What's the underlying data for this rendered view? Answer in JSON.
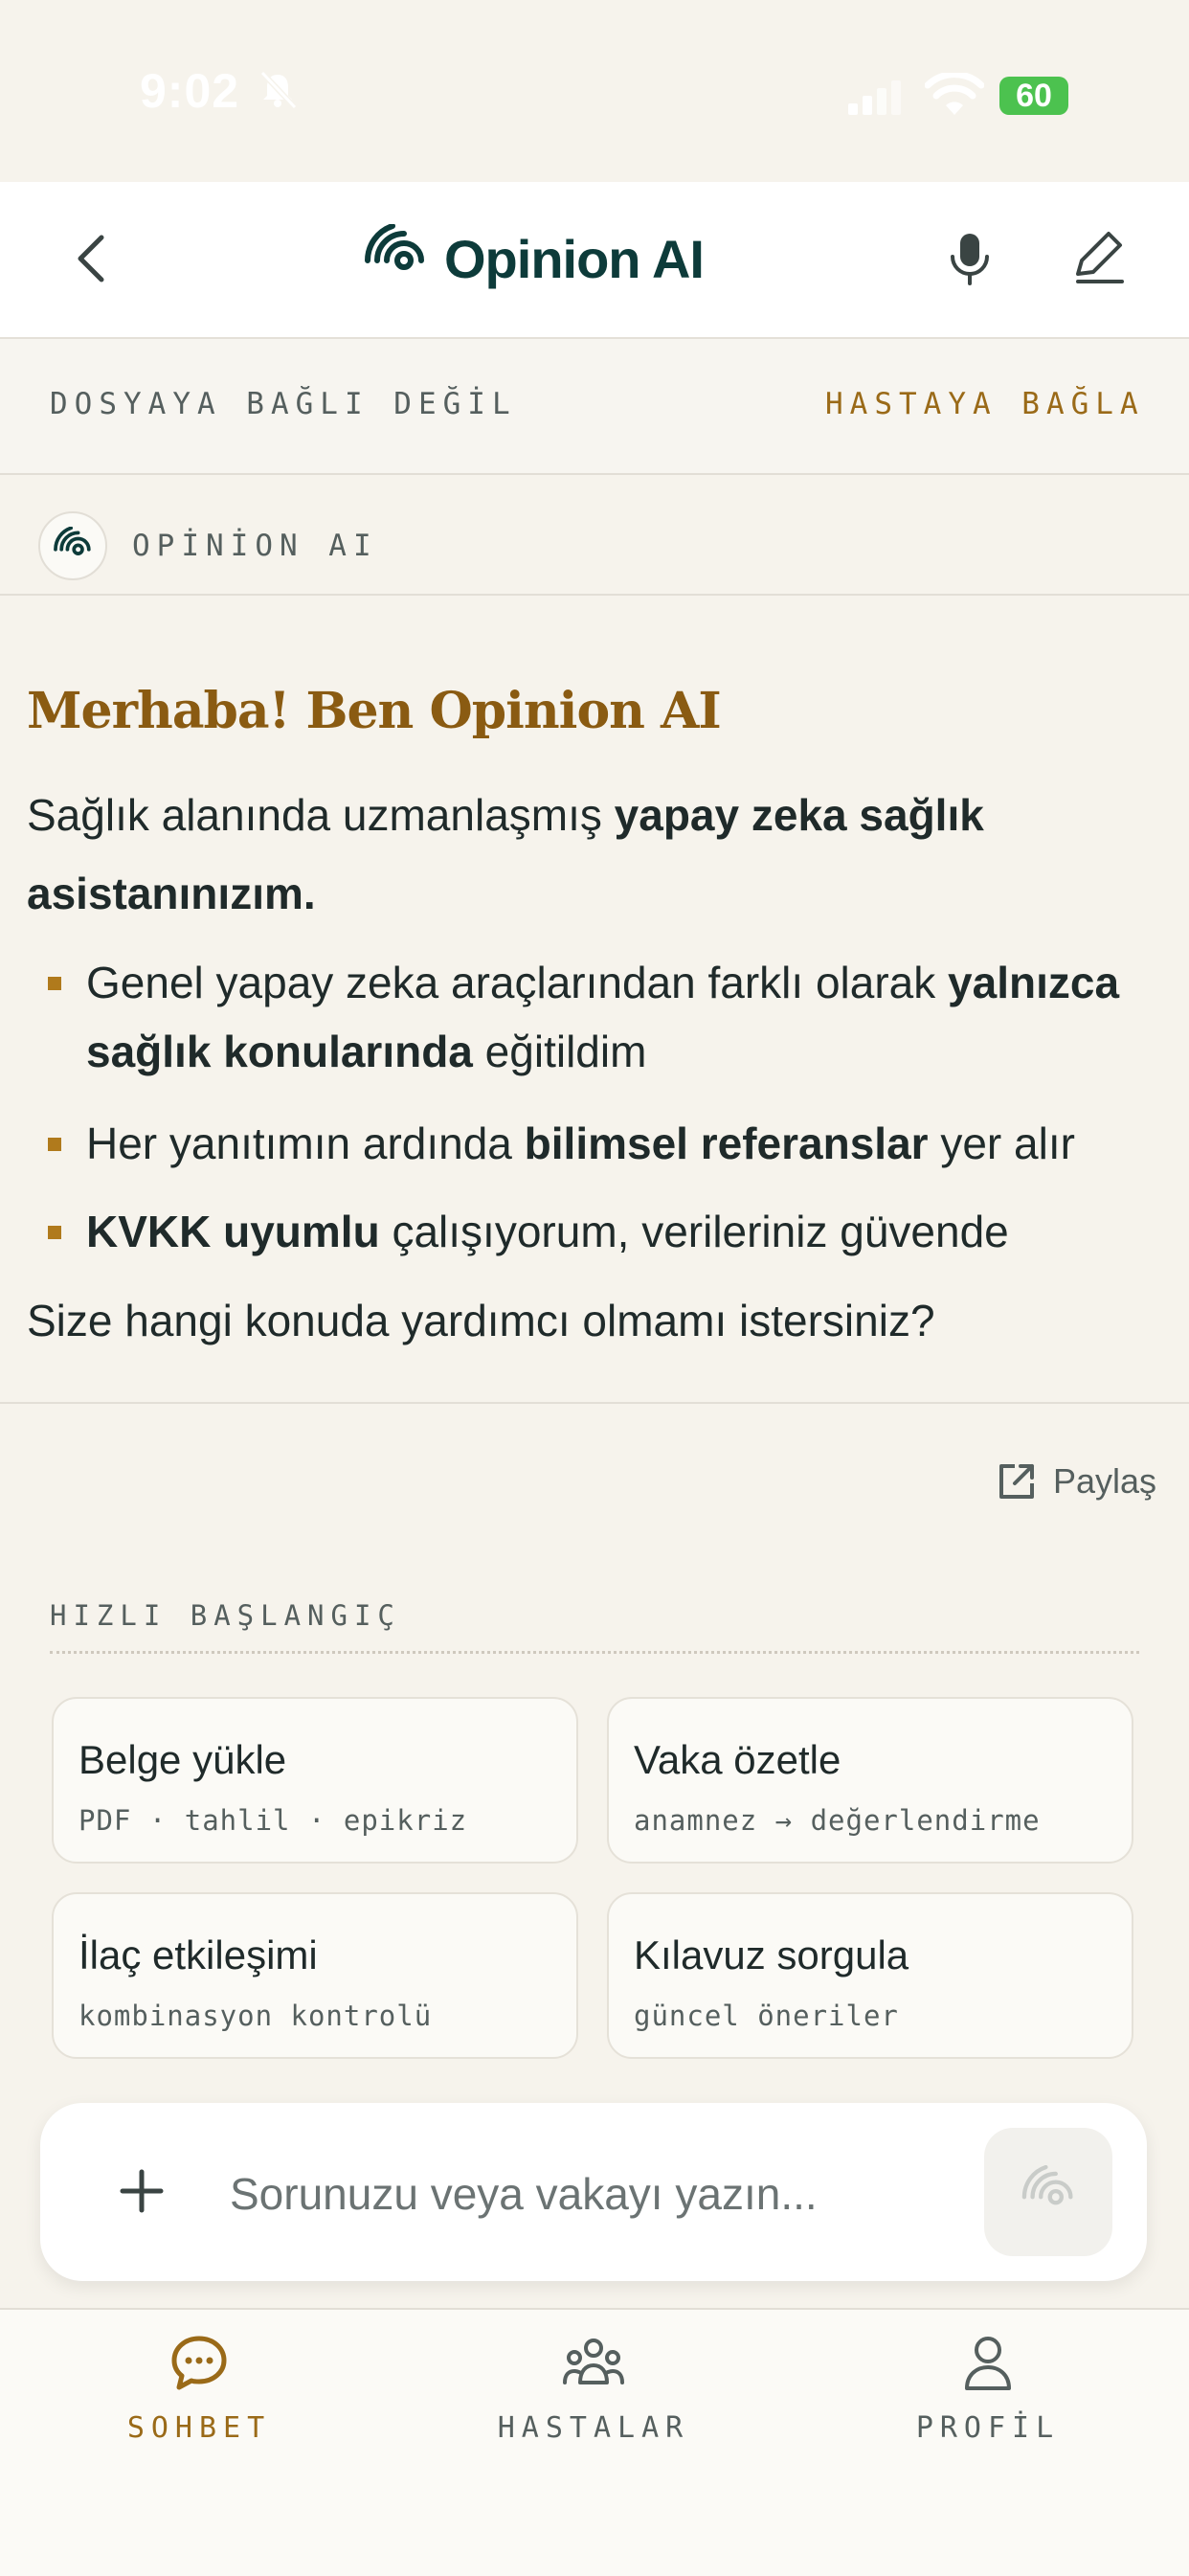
{
  "status_bar": {
    "time": "9:02",
    "battery": "60"
  },
  "header": {
    "title": "Opinion AI"
  },
  "file_bar": {
    "status": "DOSYAYA BAĞLI DEĞİL",
    "connect_label": "HASTAYA BAĞLA"
  },
  "message": {
    "sender": "OPİNİON AI",
    "greeting": "Merhaba! Ben Opinion AI",
    "intro_plain": "Sağlık alanında uzmanlaşmış ",
    "intro_bold": "yapay zeka sağlık asistanınızım.",
    "bullets": [
      {
        "pre": "Genel yapay zeka araçlarından farklı olarak ",
        "bold": "yalnızca sağlık konularında",
        "post": " eğitildim"
      },
      {
        "pre": "Her yanıtımın ardında ",
        "bold": "bilimsel referanslar",
        "post": " yer alır"
      },
      {
        "pre": "",
        "bold": "KVKK uyumlu",
        "post": " çalışıyorum, verileriniz güvende"
      }
    ],
    "question": "Size hangi konuda yardımcı olmamı istersiniz?"
  },
  "share_label": "Paylaş",
  "quick_start": {
    "label": "HIZLI BAŞLANGIÇ",
    "cards": [
      {
        "title": "Belge yükle",
        "subtitle": "PDF · tahlil · epikriz"
      },
      {
        "title": "Vaka özetle",
        "subtitle": "anamnez → değerlendirme"
      },
      {
        "title": "İlaç etkileşimi",
        "subtitle": "kombinasyon kontrolü"
      },
      {
        "title": "Kılavuz sorgula",
        "subtitle": "güncel öneriler"
      }
    ]
  },
  "composer": {
    "placeholder": "Sorunuzu veya vakayı yazın..."
  },
  "nav": {
    "items": [
      {
        "label": "SOHBET",
        "icon": "chat-bubble-icon",
        "active": true
      },
      {
        "label": "HASTALAR",
        "icon": "patients-icon",
        "active": false
      },
      {
        "label": "PROFİL",
        "icon": "profile-icon",
        "active": false
      }
    ]
  },
  "colors": {
    "accent": "#9a6a18",
    "brand": "#0d3b3a",
    "background": "#f6f3ec"
  }
}
